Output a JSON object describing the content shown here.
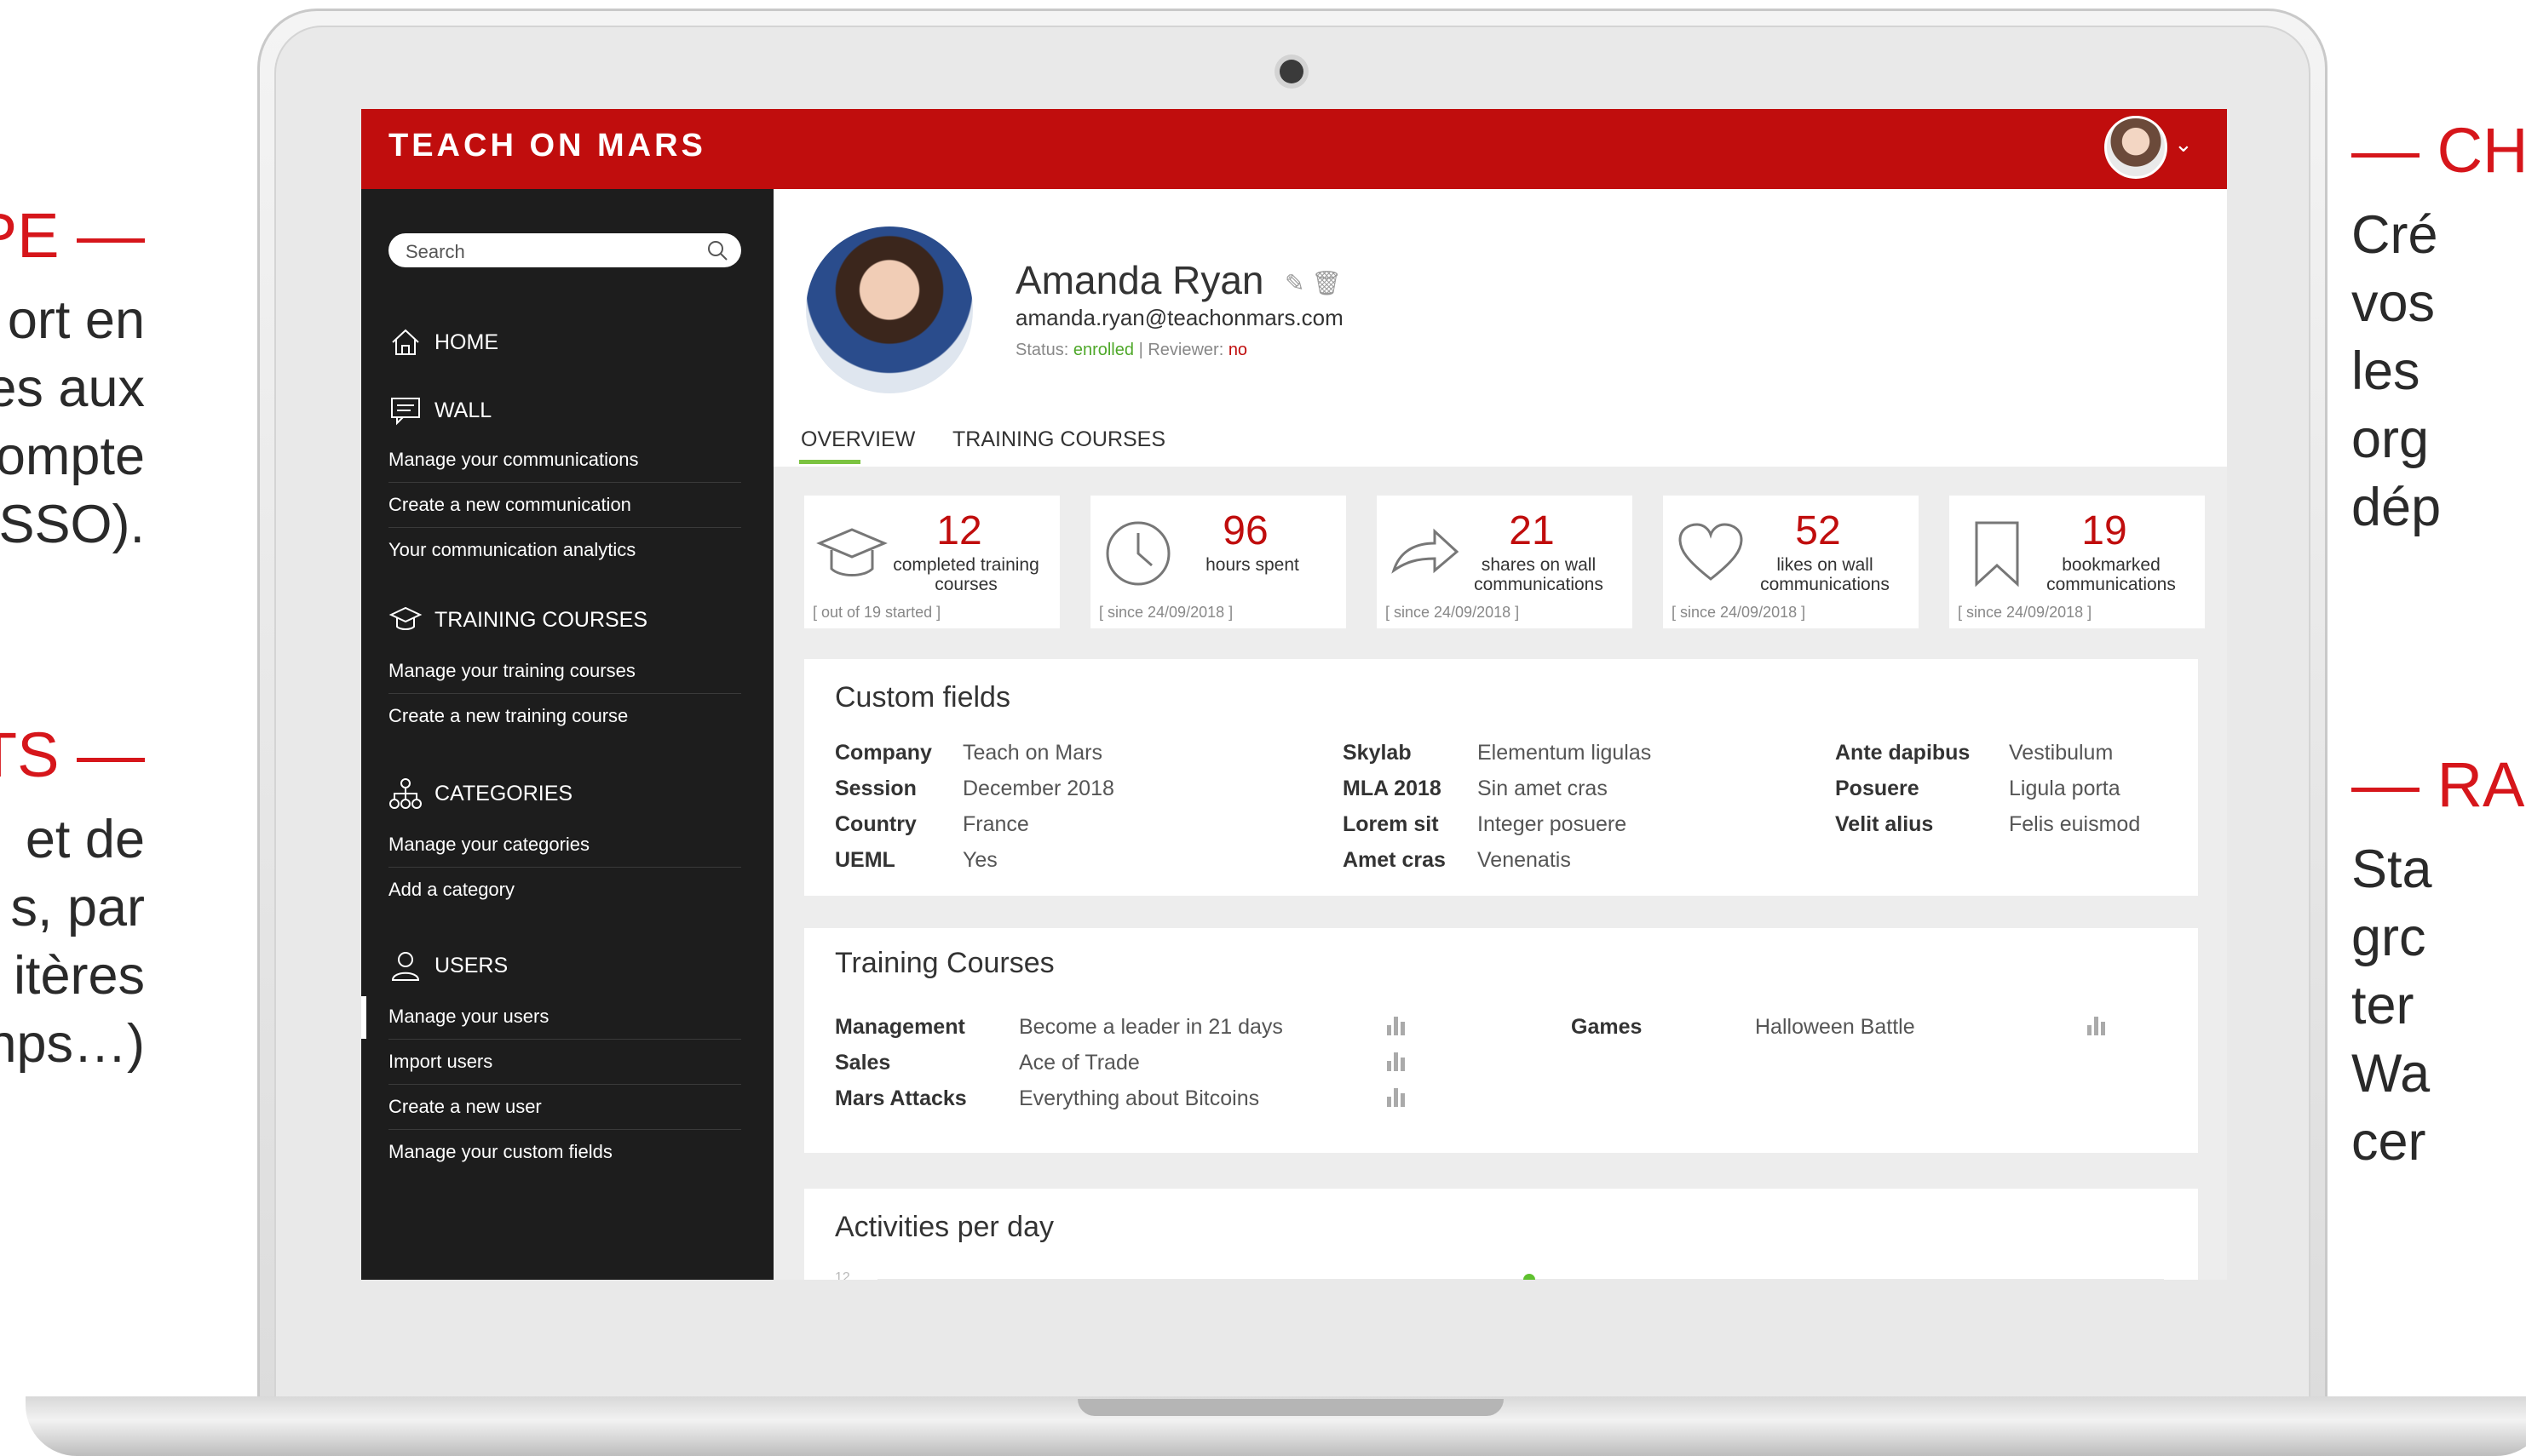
{
  "promo": {
    "left_1": {
      "head": "OUPE",
      "lines": [
        "ort en",
        "es aux",
        "ompte",
        "SSO)."
      ]
    },
    "left_2": {
      "head": "ENTS",
      "lines": [
        "et de",
        "s, par",
        "itères",
        "nps…)"
      ]
    },
    "right_1": {
      "head": "CH",
      "lines": [
        "Cré",
        "vos",
        "les",
        "org",
        "dép"
      ]
    },
    "right_2": {
      "head": "RA",
      "lines": [
        "Sta",
        "grc",
        "ter",
        "Wa",
        "cer"
      ]
    }
  },
  "app": {
    "logo": "TEACH ON MARS",
    "search_placeholder": "Search",
    "nav": {
      "home": "HOME",
      "wall": "WALL",
      "wall_items": [
        "Manage your communications",
        "Create a new communication",
        "Your communication analytics"
      ],
      "training": "TRAINING COURSES",
      "training_items": [
        "Manage your training courses",
        "Create a new training course"
      ],
      "categories": "CATEGORIES",
      "categories_items": [
        "Manage your categories",
        "Add a category"
      ],
      "users": "USERS",
      "users_items": [
        "Manage your users",
        "Import users",
        "Create a new user",
        "Manage your custom fields"
      ]
    },
    "profile": {
      "name": "Amanda Ryan",
      "email": "amanda.ryan@teachonmars.com",
      "status_label": "Status:",
      "status_value": "enrolled",
      "separator": "|",
      "reviewer_label": "Reviewer:",
      "reviewer_value": "no"
    },
    "tabs": [
      "OVERVIEW",
      "TRAINING COURSES"
    ],
    "stats": [
      {
        "icon": "graduation-cap-icon",
        "value": "12",
        "label": "completed training courses",
        "note": "[ out of 19 started ]"
      },
      {
        "icon": "clock-icon",
        "value": "96",
        "label": "hours spent",
        "note": "[ since 24/09/2018 ]"
      },
      {
        "icon": "share-arrow-icon",
        "value": "21",
        "label": "shares on wall communications",
        "note": "[ since 24/09/2018 ]"
      },
      {
        "icon": "heart-icon",
        "value": "52",
        "label": "likes on wall communications",
        "note": "[ since 24/09/2018 ]"
      },
      {
        "icon": "bookmark-icon",
        "value": "19",
        "label": "bookmarked communications",
        "note": "[ since 24/09/2018 ]"
      }
    ],
    "custom_fields": {
      "title": "Custom fields",
      "columns": [
        [
          [
            "Company",
            "Teach on Mars"
          ],
          [
            "Session",
            "December 2018"
          ],
          [
            "Country",
            "France"
          ],
          [
            "UEML",
            "Yes"
          ]
        ],
        [
          [
            "Skylab",
            "Elementum ligulas"
          ],
          [
            "MLA 2018",
            "Sin amet cras"
          ],
          [
            "Lorem sit",
            "Integer posuere"
          ],
          [
            "Amet cras",
            "Venenatis"
          ]
        ],
        [
          [
            "Ante dapibus",
            "Vestibulum"
          ],
          [
            "Posuere",
            "Ligula porta"
          ],
          [
            "Velit alius",
            "Felis euismod"
          ]
        ]
      ]
    },
    "training_courses": {
      "title": "Training Courses",
      "rows": [
        [
          "Management",
          "Become a leader in 21 days"
        ],
        [
          "Sales",
          "Ace of Trade"
        ],
        [
          "Mars Attacks",
          "Everything about Bitcoins"
        ],
        [
          "Games",
          "Halloween Battle"
        ]
      ]
    },
    "activities": {
      "title": "Activities per day",
      "axis_top": "12"
    },
    "colors": {
      "brand_red": "#c00d0d",
      "accent_green": "#7cc341",
      "sidebar": "#1d1d1d"
    }
  }
}
